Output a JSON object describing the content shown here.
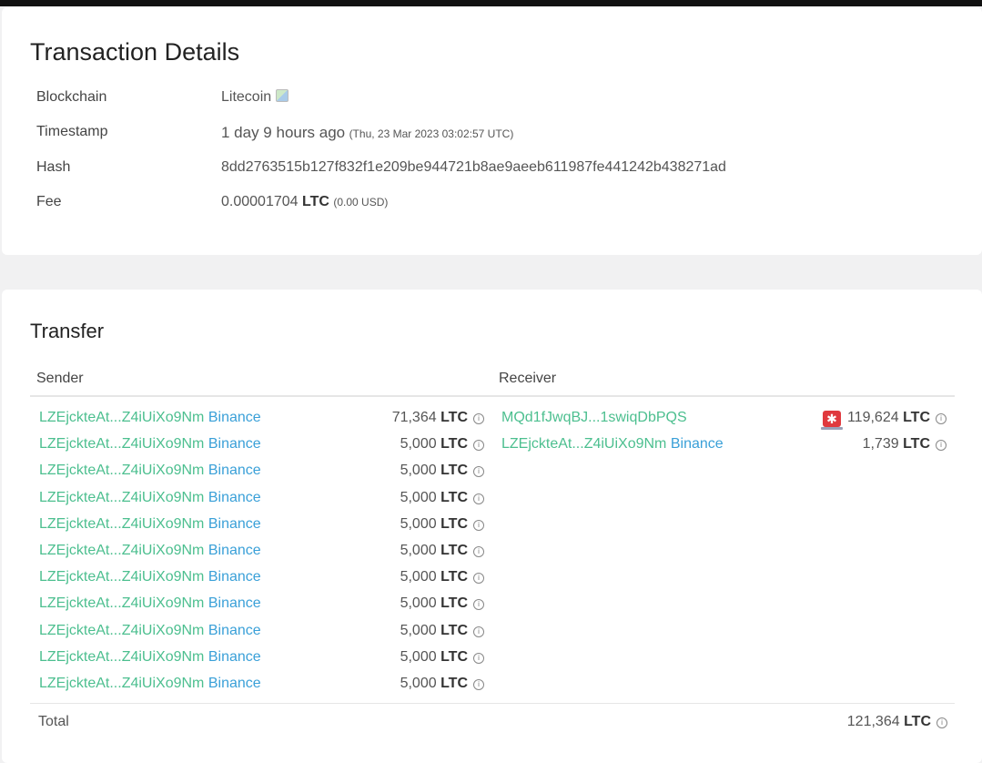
{
  "details": {
    "title": "Transaction Details",
    "rows": {
      "blockchain": {
        "label": "Blockchain",
        "value": "Litecoin"
      },
      "timestamp": {
        "label": "Timestamp",
        "relative": "1 day 9 hours ago",
        "absolute": "(Thu, 23 Mar 2023 03:02:57 UTC)"
      },
      "hash": {
        "label": "Hash",
        "value": "8dd2763515b127f832f1e209be944721b8ae9aeeb611987fe441242b438271ad"
      },
      "fee": {
        "label": "Fee",
        "amount": "0.00001704",
        "unit": "LTC",
        "usd": "(0.00 USD)"
      }
    }
  },
  "transfer": {
    "title": "Transfer",
    "sender_header": "Sender",
    "receiver_header": "Receiver",
    "senders": [
      {
        "address": "LZEjckteAt...Z4iUiXo9Nm",
        "tag": "Binance",
        "amount": "71,364",
        "unit": "LTC"
      },
      {
        "address": "LZEjckteAt...Z4iUiXo9Nm",
        "tag": "Binance",
        "amount": "5,000",
        "unit": "LTC"
      },
      {
        "address": "LZEjckteAt...Z4iUiXo9Nm",
        "tag": "Binance",
        "amount": "5,000",
        "unit": "LTC"
      },
      {
        "address": "LZEjckteAt...Z4iUiXo9Nm",
        "tag": "Binance",
        "amount": "5,000",
        "unit": "LTC"
      },
      {
        "address": "LZEjckteAt...Z4iUiXo9Nm",
        "tag": "Binance",
        "amount": "5,000",
        "unit": "LTC"
      },
      {
        "address": "LZEjckteAt...Z4iUiXo9Nm",
        "tag": "Binance",
        "amount": "5,000",
        "unit": "LTC"
      },
      {
        "address": "LZEjckteAt...Z4iUiXo9Nm",
        "tag": "Binance",
        "amount": "5,000",
        "unit": "LTC"
      },
      {
        "address": "LZEjckteAt...Z4iUiXo9Nm",
        "tag": "Binance",
        "amount": "5,000",
        "unit": "LTC"
      },
      {
        "address": "LZEjckteAt...Z4iUiXo9Nm",
        "tag": "Binance",
        "amount": "5,000",
        "unit": "LTC"
      },
      {
        "address": "LZEjckteAt...Z4iUiXo9Nm",
        "tag": "Binance",
        "amount": "5,000",
        "unit": "LTC"
      },
      {
        "address": "LZEjckteAt...Z4iUiXo9Nm",
        "tag": "Binance",
        "amount": "5,000",
        "unit": "LTC"
      }
    ],
    "receivers": [
      {
        "address": "MQd1fJwqBJ...1swiqDbPQS",
        "tag": "",
        "amount": "119,624",
        "unit": "LTC",
        "icon": "alert-siren-icon"
      },
      {
        "address": "LZEjckteAt...Z4iUiXo9Nm",
        "tag": "Binance",
        "amount": "1,739",
        "unit": "LTC",
        "icon": ""
      }
    ],
    "total": {
      "label": "Total",
      "amount": "121,364",
      "unit": "LTC"
    }
  },
  "colors": {
    "address": "#4cbf8f",
    "tag": "#3aa0d8",
    "alert": "#e0393e"
  }
}
